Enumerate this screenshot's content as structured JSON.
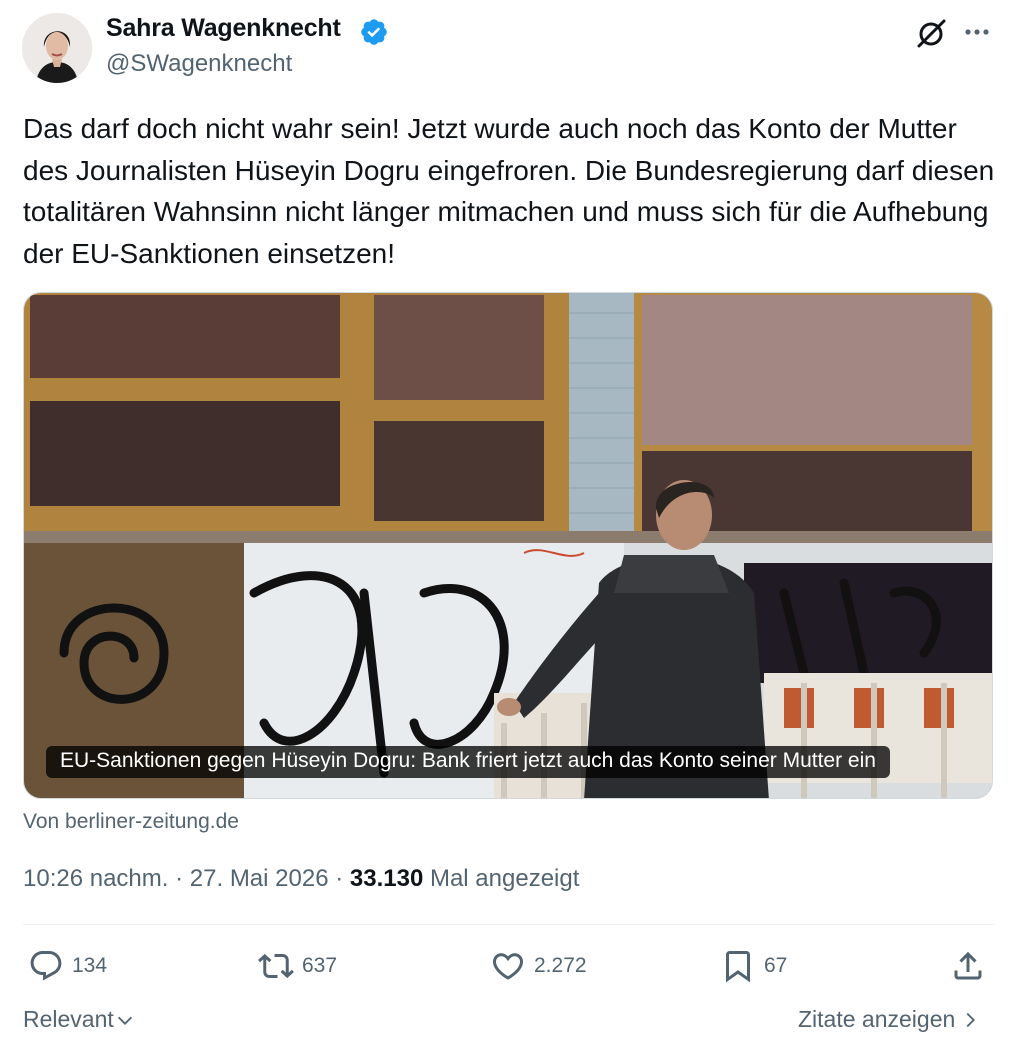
{
  "author": {
    "display_name": "Sahra Wagenknecht",
    "handle": "@SWagenknecht",
    "verified": true
  },
  "tweet": {
    "text": "Das darf doch nicht wahr sein! Jetzt wurde auch noch das Konto der Mutter des Journalisten Hüseyin Dogru eingefroren. Die Bundesregierung darf diesen totalitären Wahnsinn nicht länger mitmachen und muss sich für die Aufhebung der EU-Sanktionen einsetzen!"
  },
  "media": {
    "caption": "EU-Sanktionen gegen Hüseyin Dogru: Bank friert jetzt auch das Konto seiner Mutter ein",
    "source": "Von berliner-zeitung.de"
  },
  "meta": {
    "time": "10:26 nachm.",
    "separator": "·",
    "date": "27. Mai 2026",
    "views_count": "33.130",
    "views_label": "Mal angezeigt"
  },
  "actions": {
    "replies": "134",
    "retweets": "637",
    "likes": "2.272",
    "bookmarks": "67"
  },
  "footer": {
    "sort_label": "Relevant",
    "quotes_label": "Zitate anzeigen"
  },
  "colors": {
    "text": "#0f1419",
    "secondary": "#536471",
    "verified": "#1d9bf0",
    "divider": "#eff3f4"
  }
}
